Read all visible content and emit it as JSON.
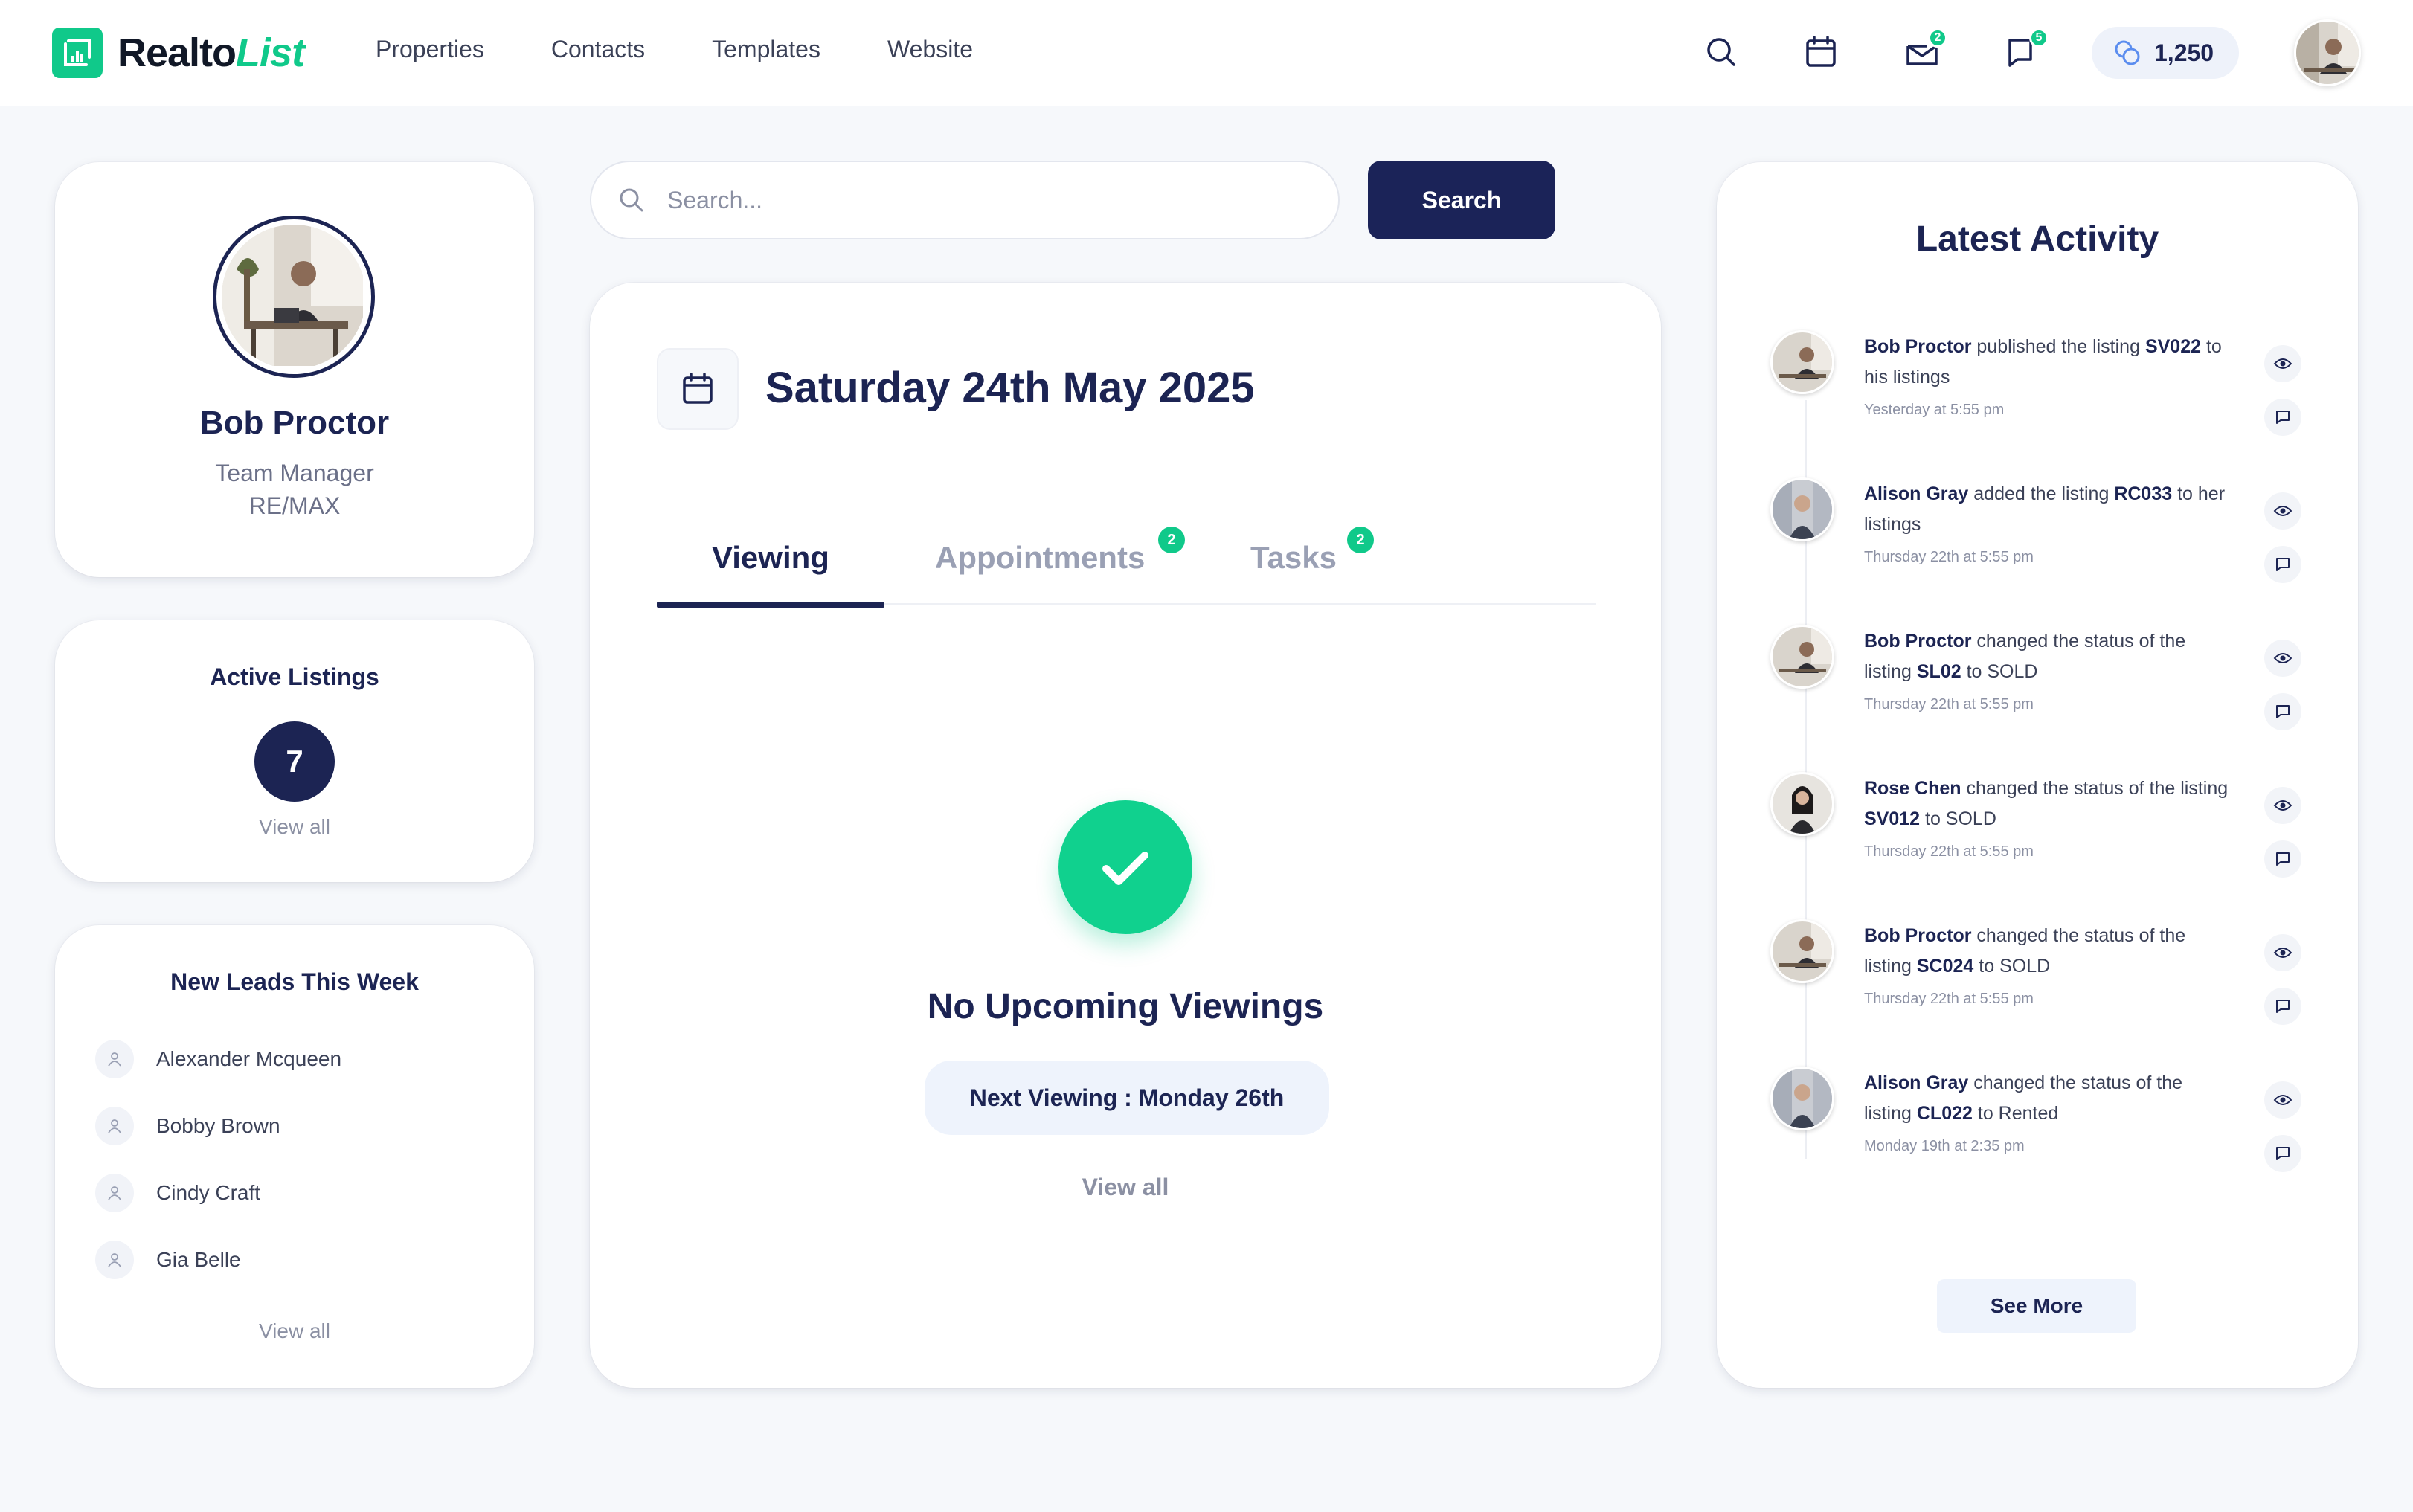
{
  "brand": {
    "name_part1": "Realto",
    "name_part2": "List",
    "accent_color": "#10c98a",
    "primary_color": "#1c2453"
  },
  "nav": {
    "links": [
      "Properties",
      "Contacts",
      "Templates",
      "Website"
    ],
    "icons": [
      "search-icon",
      "calendar-icon",
      "mail-icon",
      "chat-icon"
    ],
    "mail_badge": "2",
    "chat_badge": "5",
    "credits": "1,250"
  },
  "profile": {
    "name": "Bob Proctor",
    "role": "Team Manager",
    "company": "RE/MAX"
  },
  "active_listings": {
    "title": "Active Listings",
    "count": "7",
    "view_all": "View all"
  },
  "new_leads": {
    "title": "New Leads This Week",
    "leads": [
      "Alexander Mcqueen",
      "Bobby Brown",
      "Cindy Craft",
      "Gia Belle"
    ],
    "view_all": "View all"
  },
  "search": {
    "placeholder": "Search...",
    "value": "",
    "button": "Search"
  },
  "schedule": {
    "date": "Saturday 24th May 2025",
    "tabs": [
      {
        "label": "Viewing",
        "badge": "",
        "active": true
      },
      {
        "label": "Appointments",
        "badge": "2",
        "active": false
      },
      {
        "label": "Tasks",
        "badge": "2",
        "active": false
      }
    ],
    "empty_title": "No Upcoming Viewings",
    "next_viewing": "Next Viewing : Monday 26th",
    "view_all": "View all"
  },
  "activity": {
    "title": "Latest Activity",
    "items": [
      {
        "user": "Bob Proctor",
        "text1": " published the listing ",
        "code": "SV022",
        "text2": " to his listings",
        "time": "Yesterday at 5:55 pm"
      },
      {
        "user": "Alison Gray",
        "text1": " added the listing ",
        "code": "RC033",
        "text2": " to her listings",
        "time": "Thursday 22th at 5:55 pm"
      },
      {
        "user": "Bob Proctor",
        "text1": " changed the status of the listing ",
        "code": "SL02",
        "text2": " to SOLD",
        "time": "Thursday 22th at 5:55 pm"
      },
      {
        "user": "Rose Chen",
        "text1": " changed the status of the listing ",
        "code": "SV012",
        "text2": " to SOLD",
        "time": "Thursday 22th at 5:55 pm"
      },
      {
        "user": "Bob Proctor",
        "text1": " changed the status of the listing ",
        "code": "SC024",
        "text2": " to SOLD",
        "time": "Thursday 22th at 5:55 pm"
      },
      {
        "user": "Alison Gray",
        "text1": " changed the status of the listing ",
        "code": "CL022",
        "text2": " to Rented",
        "time": "Monday 19th at 2:35 pm"
      }
    ],
    "see_more": "See More"
  }
}
